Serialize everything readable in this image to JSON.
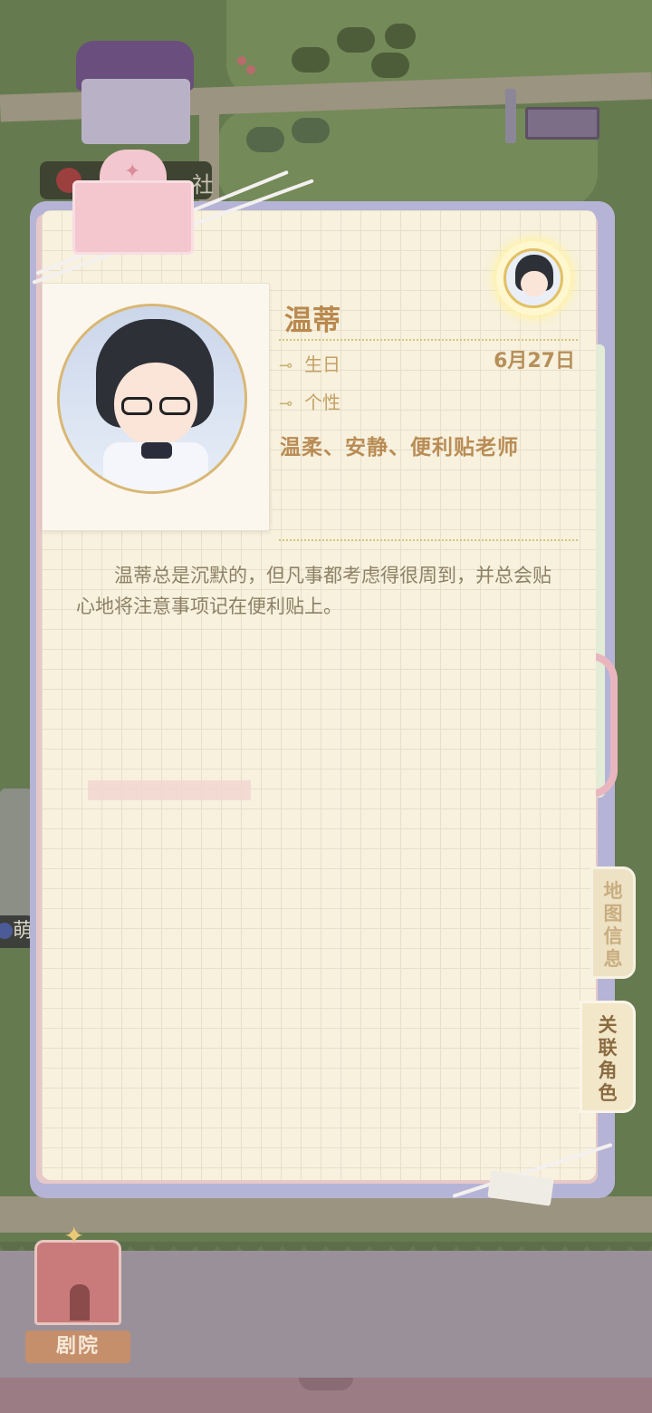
{
  "map": {
    "label_partial": "社",
    "left_badge_partial": "萌"
  },
  "character": {
    "name": "温蒂",
    "birthday_label": "生日",
    "birthday_value": "6月27日",
    "personality_label": "个性",
    "traits": "温柔、安静、便利贴老师",
    "description": "温蒂总是沉默的，但凡事都考虑得很周到，并总会贴心地将注意事项记在便利贴上。"
  },
  "side_tabs": {
    "map_info": "地图信息",
    "related_characters": "关联角色"
  },
  "bottom": {
    "theatre_label": "剧院"
  }
}
